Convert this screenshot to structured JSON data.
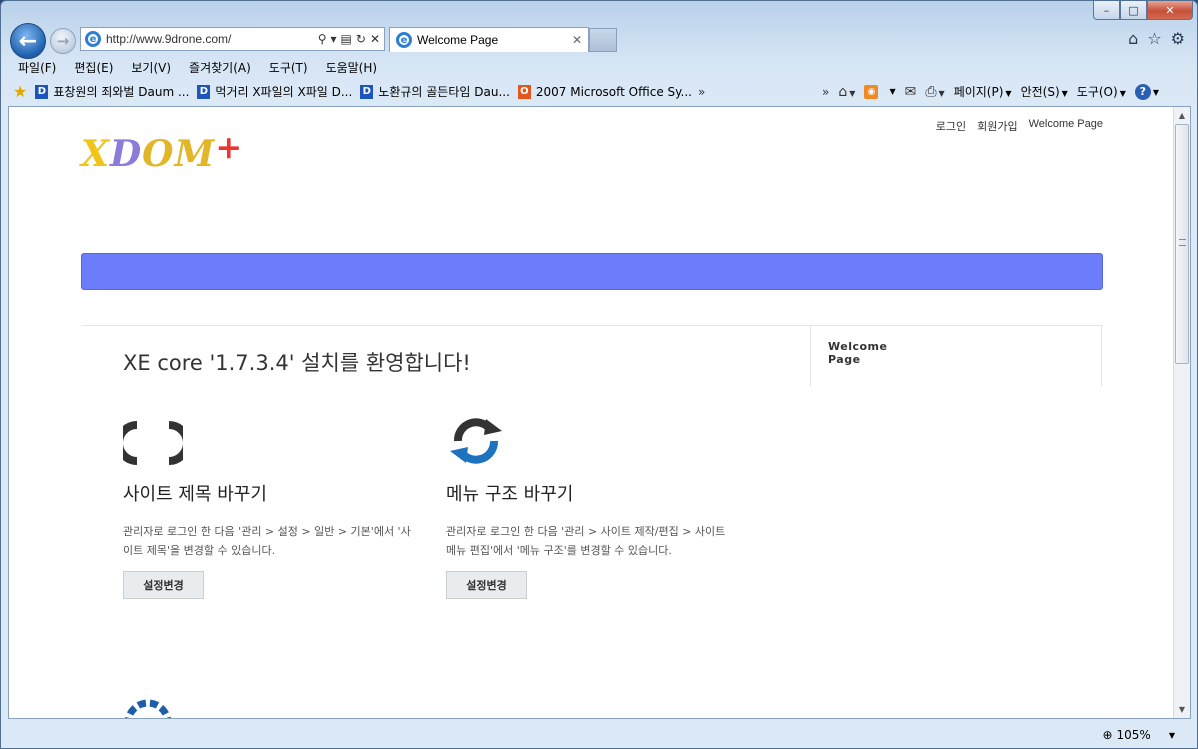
{
  "browser": {
    "caption": {
      "minimize": "–",
      "maximize": "□",
      "close": "✕"
    },
    "address": {
      "url": "http://www.9drone.com/"
    },
    "tab": {
      "title": "Welcome Page"
    },
    "menu": [
      "파일(F)",
      "편집(E)",
      "보기(V)",
      "즐겨찾기(A)",
      "도구(T)",
      "도움말(H)"
    ],
    "favorites": [
      {
        "label": "표창원의 죄와벌  Daum ..."
      },
      {
        "label": "먹거리 X파일의 X파일  D..."
      },
      {
        "label": "노환규의 골든타임  Dau..."
      },
      {
        "label": "2007 Microsoft Office Sy..."
      }
    ],
    "commands": {
      "page": "페이지(P)",
      "safety": "안전(S)",
      "tools": "도구(O)"
    },
    "status": {
      "zoom": "105%"
    },
    "colors": {
      "accent": "#1d5fae",
      "frame": "#b9d1ea"
    }
  },
  "site": {
    "top_links": [
      "로그인",
      "회원가입",
      "Welcome Page"
    ],
    "logo": {
      "part1": "X",
      "part2": "D",
      "part3": "OM",
      "plus": "+"
    },
    "navbar_color": "#6d7cfa",
    "sidebar": {
      "link": "Welcome Page"
    },
    "welcome": {
      "title": "XE core '1.7.3.4' 설치를 환영합니다!"
    },
    "cards": [
      {
        "title": "사이트 제목 바꾸기",
        "desc": "관리자로 로그인 한 다음 '관리 > 설정 > 일반 > 기본'에서 '사이트 제목'을 변경할 수 있습니다.",
        "button": "설정변경"
      },
      {
        "title": "메뉴 구조 바꾸기",
        "desc": "관리자로 로그인 한 다음 '관리 > 사이트 제작/편집 > 사이트 메뉴 편집'에서 '메뉴 구조'를 변경할 수 있습니다.",
        "button": "설정변경"
      }
    ]
  }
}
